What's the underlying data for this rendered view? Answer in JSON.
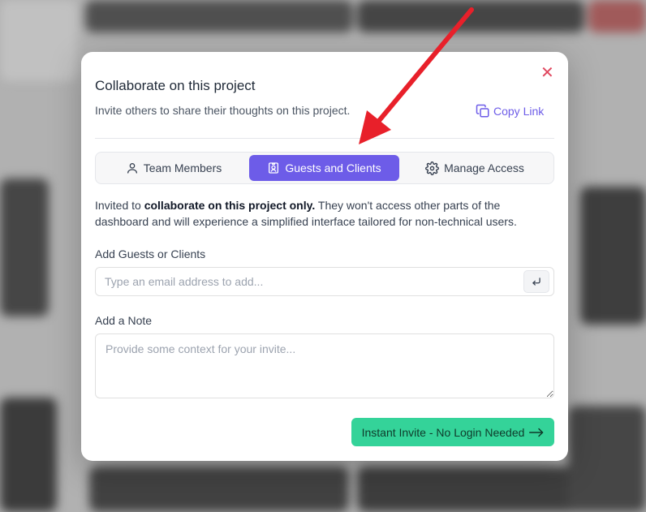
{
  "modal": {
    "title": "Collaborate on this project",
    "subtitle": "Invite others to share their thoughts on this project.",
    "copy_link_label": "Copy Link"
  },
  "tabs": [
    {
      "label": "Team Members",
      "icon": "user-icon",
      "active": false
    },
    {
      "label": "Guests and Clients",
      "icon": "id-badge-icon",
      "active": true
    },
    {
      "label": "Manage Access",
      "icon": "gear-icon",
      "active": false
    }
  ],
  "description": {
    "prefix": "Invited to ",
    "bold": "collaborate on this project only.",
    "suffix": " They won't access other parts of the dashboard and will experience a simplified interface tailored for non-technical users."
  },
  "guests": {
    "label": "Add Guests or Clients",
    "placeholder": "Type an email address to add...",
    "value": ""
  },
  "note": {
    "label": "Add a Note",
    "placeholder": "Provide some context for your invite...",
    "value": ""
  },
  "invite_button": {
    "label": "Instant Invite - No Login Needed"
  },
  "colors": {
    "accent": "#6d5ce8",
    "close": "#e0475f",
    "invite": "#34d399",
    "annotation_arrow": "#e8202a"
  }
}
